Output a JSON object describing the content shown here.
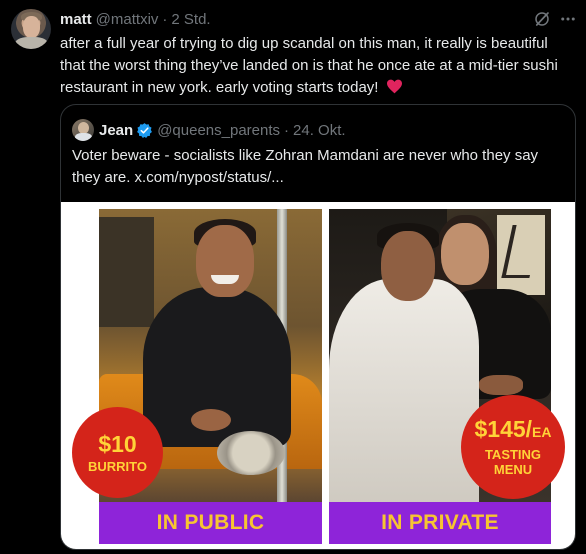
{
  "post": {
    "author_name": "matt",
    "author_handle": "@mattxiv",
    "separator": "·",
    "time": "2 Std.",
    "text": "after a full year of trying to dig up scandal on this man, it really is beautiful that the worst thing they’ve landed on is that he once ate at a mid-tier sushi restaurant in new york. early voting starts today!",
    "heart_emoji": "❤️"
  },
  "icons": {
    "grok": "grok-icon",
    "more": "more-icon",
    "verified": "verified-badge-icon",
    "heart": "heart-icon"
  },
  "quote": {
    "author_name": "Jean",
    "author_handle": "@queens_parents",
    "separator": "·",
    "time": "24. Okt.",
    "text": "Voter beware - socialists like Zohran Mamdani are never who they say they are.  x.com/nypost/status/..."
  },
  "image": {
    "left_badge_price": "$10",
    "left_badge_label": "BURRITO",
    "right_badge_price": "$145/",
    "right_badge_unit": "EA",
    "right_badge_label_1": "TASTING",
    "right_badge_label_2": "MENU",
    "left_banner": "IN PUBLIC",
    "right_banner": "IN PRIVATE"
  },
  "colors": {
    "background": "#000000",
    "text": "#e7e9ea",
    "muted": "#71767b",
    "verified_blue": "#1d9bf0",
    "heart_red": "#f91880",
    "badge_red": "#d4241a",
    "badge_text": "#ffd338",
    "banner_purple": "#8e24d9",
    "banner_text": "#f7c531"
  }
}
